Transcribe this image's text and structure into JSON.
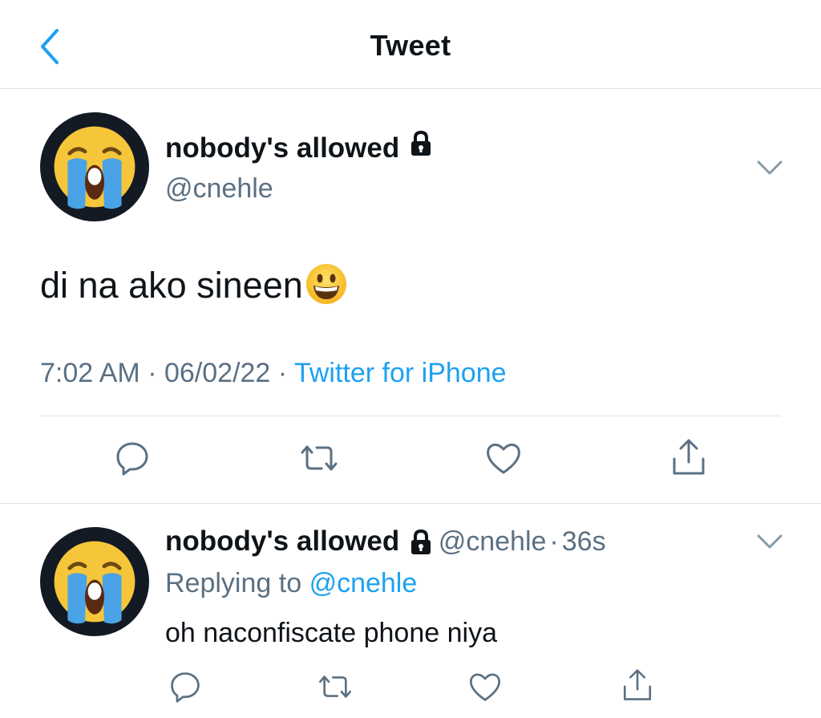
{
  "header": {
    "title": "Tweet",
    "back_icon": "chevron-left-icon"
  },
  "main_tweet": {
    "author_name": "nobody's allowed",
    "author_handle": "@cnehle",
    "avatar_icon": "loudly-crying-face-emoji",
    "protected_icon": "lock-icon",
    "text": "di na ako sineen",
    "text_emoji": "grinning-face-emoji",
    "time": "7:02 AM",
    "date": "06/02/22",
    "separator": "·",
    "source": "Twitter for iPhone",
    "actions": [
      "reply-icon",
      "retweet-icon",
      "like-icon",
      "share-icon"
    ]
  },
  "reply_tweet": {
    "author_name": "nobody's allowed",
    "author_handle": "@cnehle",
    "separator": "·",
    "timestamp": "36s",
    "replying_prefix": "Replying to",
    "replying_to": "@cnehle",
    "text": "oh naconfiscate phone niya",
    "actions": [
      "reply-icon",
      "retweet-icon",
      "like-icon",
      "share-icon"
    ]
  },
  "colors": {
    "accent": "#1da1f2",
    "secondary_text": "#5b7083",
    "primary_text": "#0f1419",
    "divider": "#dfe3e6",
    "avatar_bg": "#141a24"
  }
}
